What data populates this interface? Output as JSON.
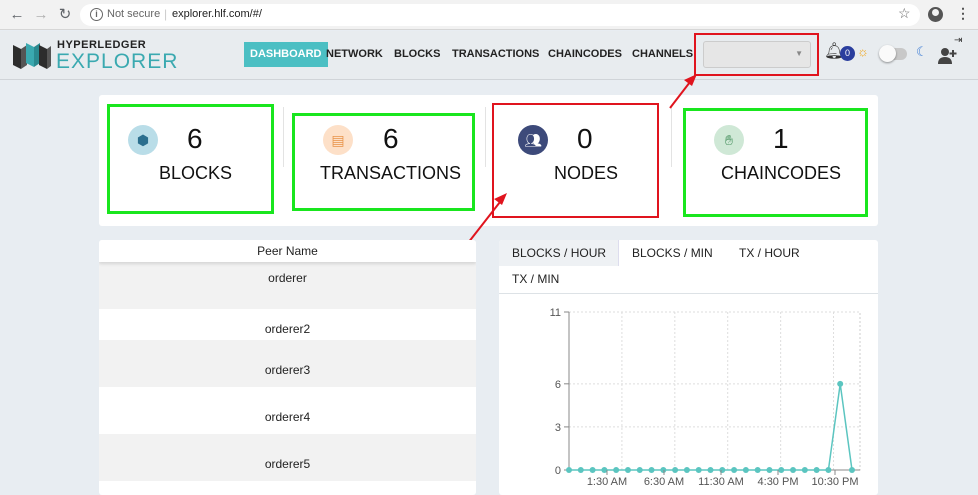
{
  "browser": {
    "security": "Not secure",
    "url": "explorer.hlf.com/#/"
  },
  "header": {
    "logo_top": "HYPERLEDGER",
    "logo_bottom": "EXPLORER",
    "nav": [
      "DASHBOARD",
      "NETWORK",
      "BLOCKS",
      "TRANSACTIONS",
      "CHAINCODES",
      "CHANNELS"
    ],
    "active_nav": "DASHBOARD",
    "channel_selected": "",
    "notification_count": "0",
    "accent_color": "#4bbfc3"
  },
  "stats": [
    {
      "value": "6",
      "label": "BLOCKS",
      "icon": "cube-icon"
    },
    {
      "value": "6",
      "label": "TRANSACTIONS",
      "icon": "receipt-icon"
    },
    {
      "value": "0",
      "label": "NODES",
      "icon": "users-icon"
    },
    {
      "value": "1",
      "label": "CHAINCODES",
      "icon": "handshake-icon"
    }
  ],
  "peers": {
    "header": "Peer Name",
    "rows": [
      "orderer",
      "orderer2",
      "orderer3",
      "orderer4",
      "orderer5"
    ]
  },
  "chart_tabs": [
    "BLOCKS / HOUR",
    "BLOCKS / MIN",
    "TX / HOUR",
    "TX / MIN"
  ],
  "active_chart_tab": "BLOCKS / HOUR",
  "chart_data": {
    "type": "line",
    "title": "",
    "xlabel": "",
    "ylabel": "",
    "yticks": [
      0,
      3,
      6,
      11
    ],
    "ylim": [
      0,
      11
    ],
    "xtick_labels": [
      "1:30 AM",
      "6:30 AM",
      "11:30 AM",
      "4:30 PM",
      "10:30 PM"
    ],
    "series": [
      {
        "values": [
          0,
          0,
          0,
          0,
          0,
          0,
          0,
          0,
          0,
          0,
          0,
          0,
          0,
          0,
          0,
          0,
          0,
          0,
          0,
          0,
          0,
          0,
          0,
          6,
          0
        ]
      }
    ],
    "line_color": "#5bc5c0",
    "grid": true
  }
}
